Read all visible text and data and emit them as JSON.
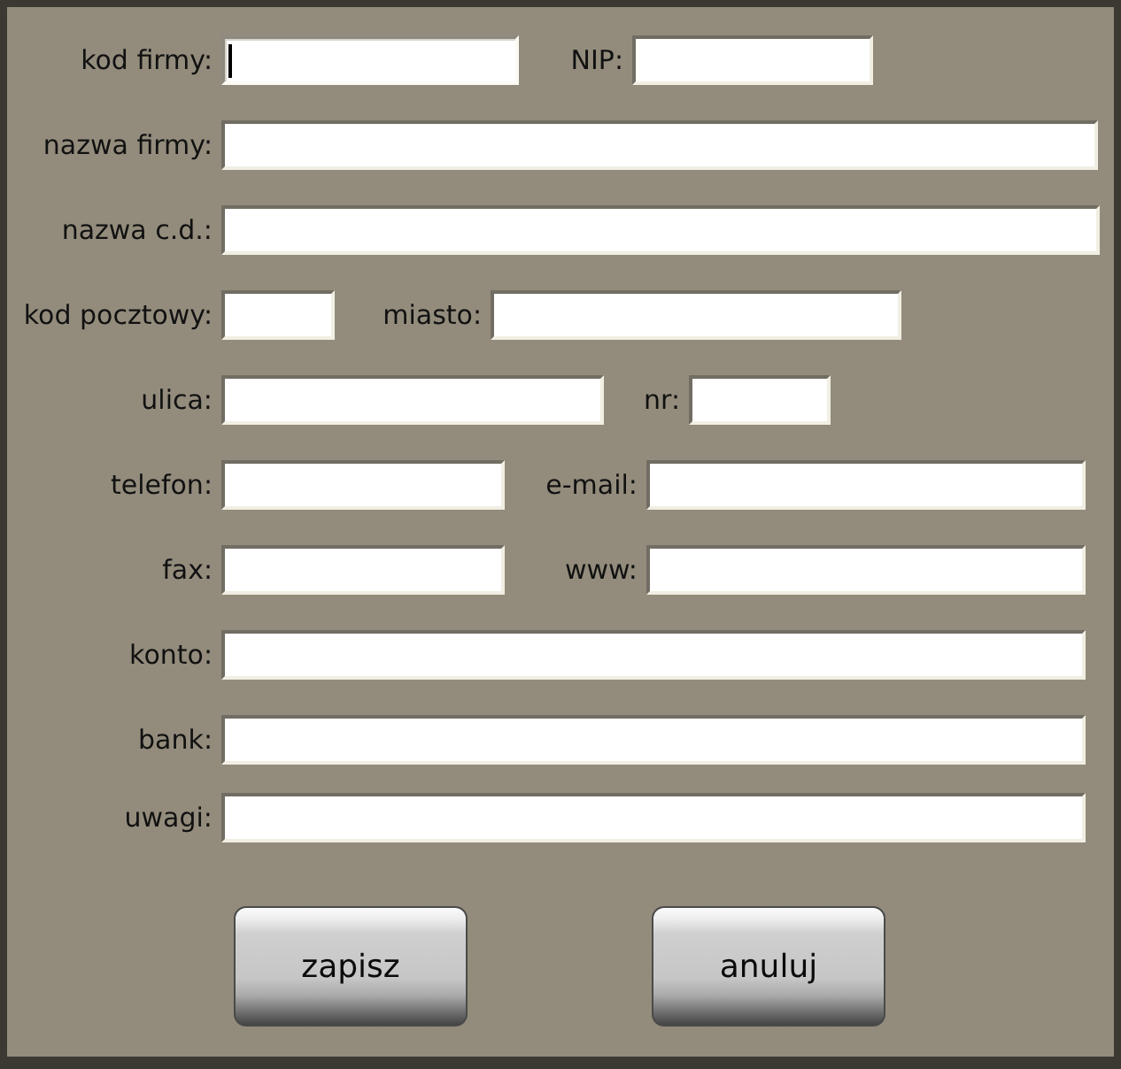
{
  "form": {
    "rows": [
      {
        "fields": [
          {
            "label": "kod firmy:",
            "focused": true
          },
          {
            "label": "NIP:",
            "focused": false
          }
        ]
      },
      {
        "fields": [
          {
            "label": "nazwa firmy:",
            "focused": false
          }
        ]
      },
      {
        "fields": [
          {
            "label": "nazwa c.d.:",
            "focused": false
          }
        ]
      },
      {
        "fields": [
          {
            "label": "kod pocztowy:",
            "focused": false
          },
          {
            "label": "miasto:",
            "focused": false
          }
        ]
      },
      {
        "fields": [
          {
            "label": "ulica:",
            "focused": false
          },
          {
            "label": "nr:",
            "focused": false
          }
        ]
      },
      {
        "fields": [
          {
            "label": "telefon:",
            "focused": false
          },
          {
            "label": "e-mail:",
            "focused": false
          }
        ]
      },
      {
        "fields": [
          {
            "label": "fax:",
            "focused": false
          },
          {
            "label": "www:",
            "focused": false
          }
        ]
      },
      {
        "fields": [
          {
            "label": "konto:",
            "focused": false
          }
        ]
      },
      {
        "fields": [
          {
            "label": "bank:",
            "focused": false
          }
        ]
      },
      {
        "fields": [
          {
            "label": "uwagi:",
            "focused": false
          }
        ]
      }
    ]
  },
  "buttons": [
    {
      "label": "zapisz"
    },
    {
      "label": "anuluj"
    }
  ]
}
